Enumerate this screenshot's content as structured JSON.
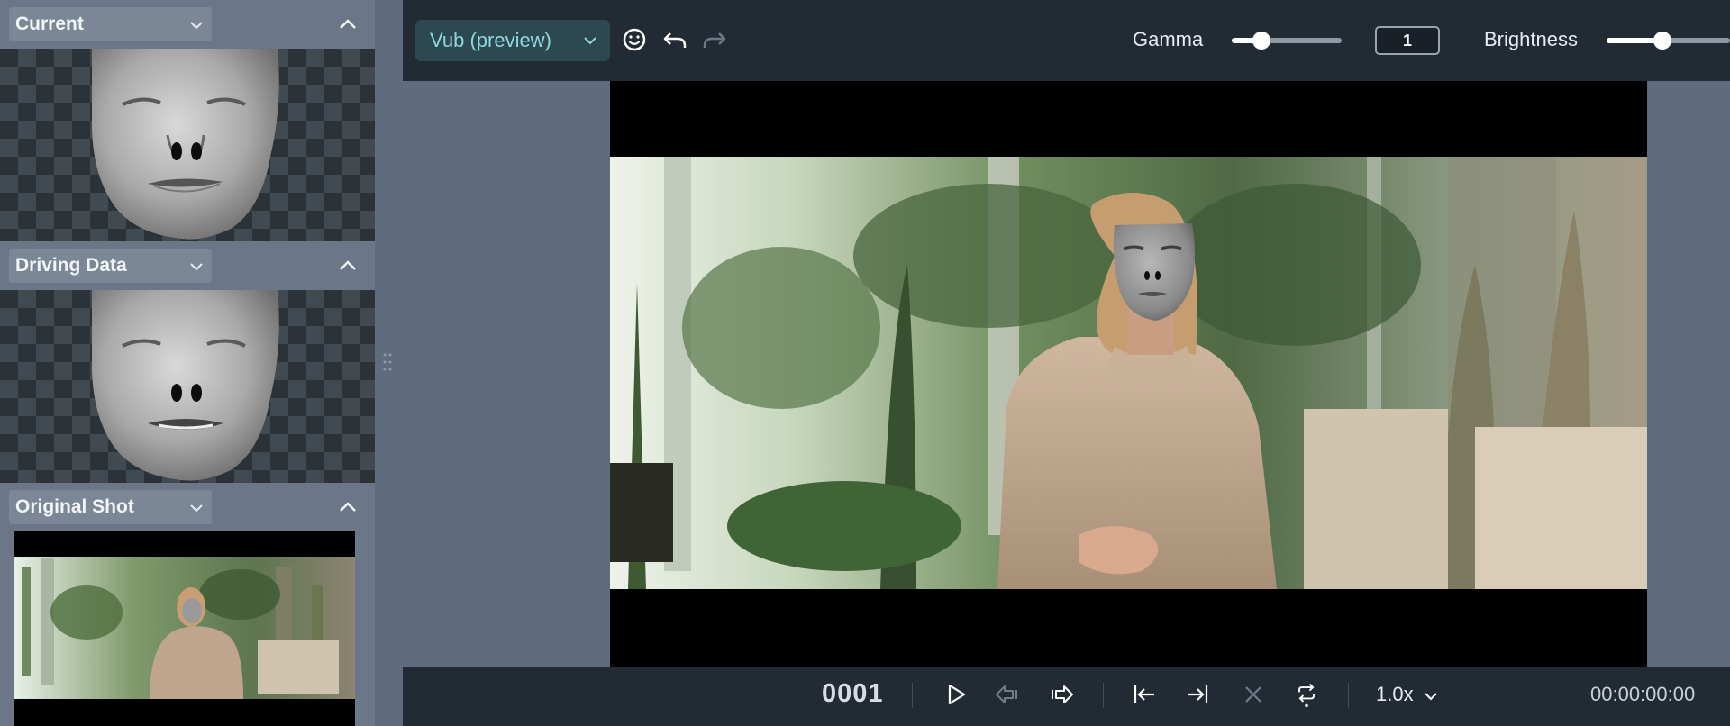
{
  "panels": {
    "current": {
      "label": "Current"
    },
    "driving": {
      "label": "Driving Data"
    },
    "original": {
      "label": "Original Shot"
    }
  },
  "toolbar": {
    "mode_label": "Vub (preview)",
    "gamma_label": "Gamma",
    "gamma_value": "1",
    "gamma_level": 0.27,
    "brightness_label": "Brightness",
    "brightness_level": 0.45
  },
  "transport": {
    "frame": "0001",
    "speed": "1.0x",
    "timecode": "00:00:00:00"
  },
  "icons": {
    "collapse": "chevron-up-icon",
    "dropdown": "chevron-down-icon",
    "face": "smiley-face-icon",
    "undo": "undo-icon",
    "redo": "redo-icon",
    "play": "play-icon",
    "prev_frame": "previous-frame-icon",
    "next_frame": "next-frame-icon",
    "go_start": "go-to-start-icon",
    "go_end": "go-to-end-icon",
    "clear": "close-icon",
    "loop": "loop-icon"
  },
  "colors": {
    "accent": "#8fd6dd",
    "toolbar_bg": "#222a33",
    "panel_bg": "#6b7788"
  }
}
